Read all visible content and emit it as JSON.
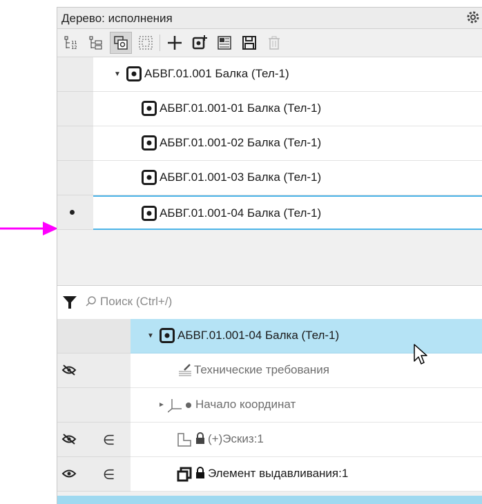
{
  "panel": {
    "title": "Дерево: исполнения",
    "toolbar_buttons": [
      "structure-list-icon",
      "structure-tree-icon",
      "variants-icon",
      "select-frame-icon",
      "add-icon",
      "create-variant-icon",
      "table-icon",
      "save-icon",
      "delete-icon"
    ]
  },
  "variants_tree": {
    "rows": [
      {
        "label": "АБВГ.01.001 Балка (Тел-1)",
        "expanded": true,
        "current": false
      },
      {
        "label": "АБВГ.01.001-01 Балка (Тел-1)",
        "current": false
      },
      {
        "label": "АБВГ.01.001-02 Балка (Тел-1)",
        "current": false
      },
      {
        "label": "АБВГ.01.001-03 Балка (Тел-1)",
        "current": false
      },
      {
        "label": "АБВГ.01.001-04 Балка (Тел-1)",
        "current": true
      }
    ]
  },
  "search": {
    "placeholder": "Поиск (Ctrl+/)"
  },
  "model_tree": {
    "rows": [
      {
        "label": "АБВГ.01.001-04 Балка (Тел-1)",
        "highlighted": true
      },
      {
        "label": "Технические требования"
      },
      {
        "label": "Начало координат"
      },
      {
        "label": "(+)Эскиз:1"
      },
      {
        "label": "Элемент выдавливания:1"
      }
    ]
  },
  "colors": {
    "highlight": "#b5e3f5",
    "selection_border": "#4cb4e8",
    "annotation_arrow": "#ff00ff"
  }
}
